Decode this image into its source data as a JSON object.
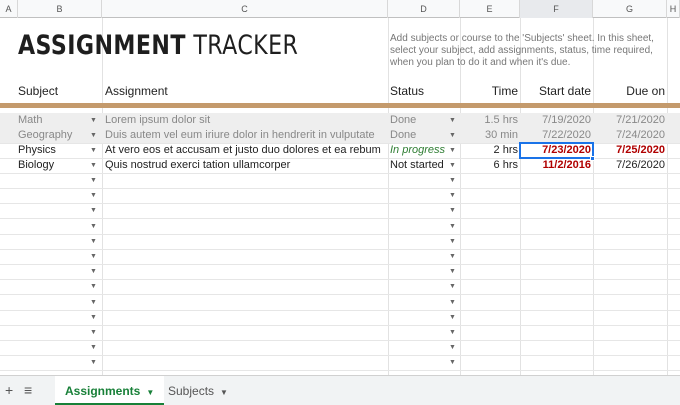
{
  "columns": [
    "A",
    "B",
    "C",
    "D",
    "E",
    "F",
    "G",
    "H"
  ],
  "selected_column": "F",
  "title": {
    "bold": "ASSIGNMENT",
    "light": " TRACKER"
  },
  "instructions": "Add subjects or course to the 'Subjects' sheet. In this sheet, select your subject, add assignments, status, time required, when you plan to do it and when it's due.",
  "headers": {
    "subject": "Subject",
    "assignment": "Assignment",
    "status": "Status",
    "time": "Time",
    "start": "Start date",
    "due": "Due on"
  },
  "colors": {
    "accent_line": "#c49a6c",
    "selection": "#1a73e8",
    "overdue": "#b00000",
    "in_progress": "#2e7d32",
    "tab_active": "#188038"
  },
  "rows": [
    {
      "subject": "Math",
      "assignment": "Lorem ipsum dolor sit",
      "status": "Done",
      "time": "1.5 hrs",
      "start": "7/19/2020",
      "due": "7/21/2020"
    },
    {
      "subject": "Geography",
      "assignment": "Duis autem vel eum iriure dolor in hendrerit in vulputate",
      "status": "Done",
      "time": "30 min",
      "start": "7/22/2020",
      "due": "7/24/2020"
    },
    {
      "subject": "Physics",
      "assignment": "At vero eos et accusam et justo duo dolores et ea rebum",
      "status": "In progress",
      "time": "2 hrs",
      "start": "7/23/2020",
      "due": "7/25/2020"
    },
    {
      "subject": "Biology",
      "assignment": "Quis nostrud exerci tation ullamcorper",
      "status": "Not started",
      "time": "6 hrs",
      "start": "11/2/2016",
      "due": "7/26/2020"
    }
  ],
  "dropdown_glyph": "▼",
  "tabbar": {
    "add_icon": "+",
    "list_icon": "≡",
    "tabs": [
      {
        "label": "Assignments",
        "active": true,
        "caret": "▼"
      },
      {
        "label": "Subjects",
        "active": false,
        "caret": "▼"
      }
    ]
  }
}
